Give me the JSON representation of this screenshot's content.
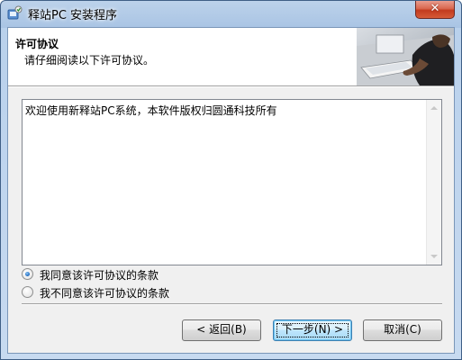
{
  "window": {
    "title": "释站PC 安装程序",
    "close_label": "✕"
  },
  "header": {
    "title": "许可协议",
    "subtitle": "请仔细阅读以下许可协议。"
  },
  "license": {
    "text": "欢迎使用新释站PC系统，本软件版权归圆通科技所有"
  },
  "options": {
    "accept_label": "我同意该许可协议的条款",
    "decline_label": "我不同意该许可协议的条款",
    "selected": "accept"
  },
  "buttons": {
    "back_label": "< 返回(B)",
    "next_label": "下一步(N) >",
    "cancel_label": "取消(C)"
  },
  "colors": {
    "accent": "#2a73c6",
    "titlebar": "#a9c4e4",
    "close": "#c23a1e"
  },
  "icons": {
    "app": "installer-app-icon",
    "close": "close-icon",
    "scroll_up": "scroll-up-arrow-icon",
    "scroll_down": "scroll-down-arrow-icon"
  }
}
